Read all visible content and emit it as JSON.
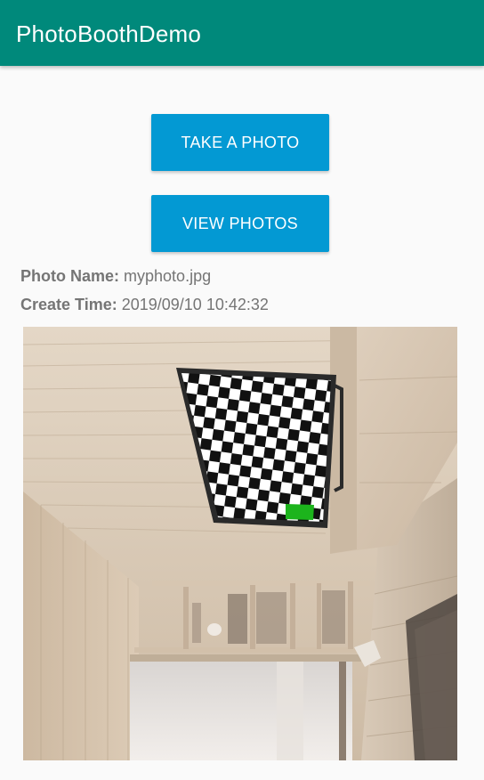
{
  "app": {
    "title": "PhotoBoothDemo",
    "bar_color": "#00897b"
  },
  "actions": {
    "take_label": "TAKE A PHOTO",
    "view_label": "VIEW PHOTOS",
    "button_color": "#0399d3"
  },
  "photo_info": {
    "name_label": "Photo Name:",
    "name_value": "myphoto.jpg",
    "time_label": "Create Time:",
    "time_value": "2019/09/10 10:42:32"
  }
}
